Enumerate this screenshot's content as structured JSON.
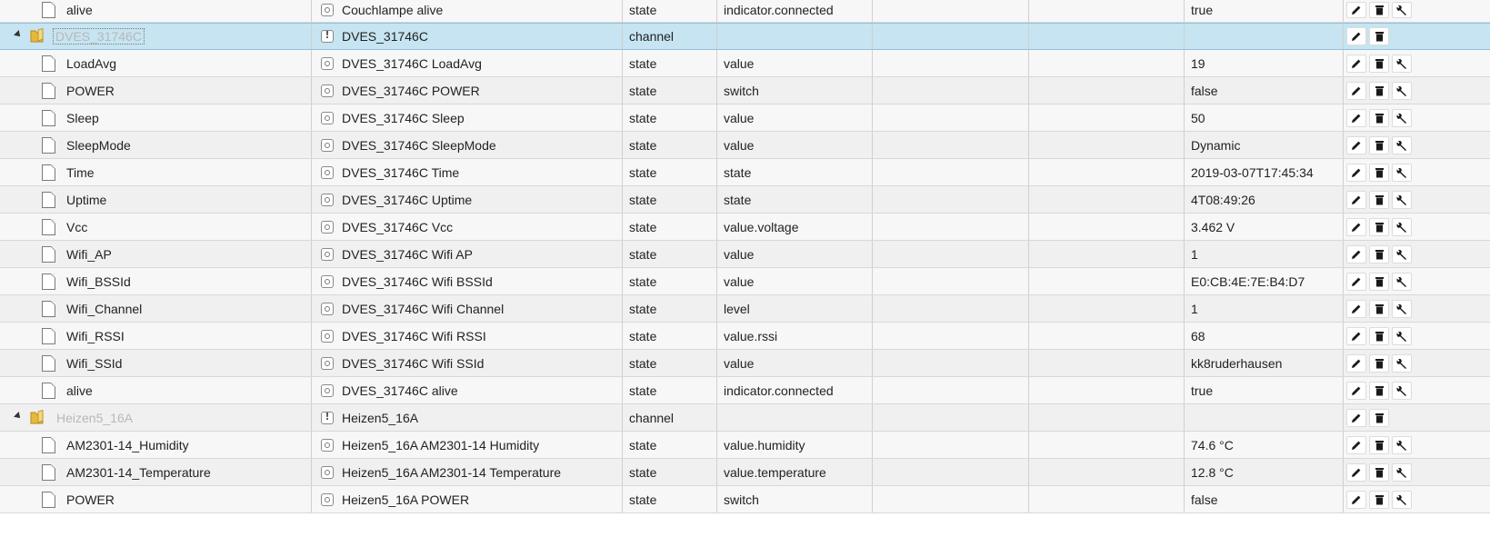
{
  "table": {
    "top_row": {
      "id": "alive",
      "name": "Couchlampe alive",
      "type": "state",
      "role": "indicator.connected",
      "value": "true"
    },
    "groups": [
      {
        "channel": {
          "id": "DVES_31746C",
          "name": "DVES_31746C",
          "type": "channel"
        },
        "rows": [
          {
            "id": "LoadAvg",
            "name": "DVES_31746C LoadAvg",
            "type": "state",
            "role": "value",
            "value": "19"
          },
          {
            "id": "POWER",
            "name": "DVES_31746C POWER",
            "type": "state",
            "role": "switch",
            "value": "false"
          },
          {
            "id": "Sleep",
            "name": "DVES_31746C Sleep",
            "type": "state",
            "role": "value",
            "value": "50"
          },
          {
            "id": "SleepMode",
            "name": "DVES_31746C SleepMode",
            "type": "state",
            "role": "value",
            "value": "Dynamic"
          },
          {
            "id": "Time",
            "name": "DVES_31746C Time",
            "type": "state",
            "role": "state",
            "value": "2019-03-07T17:45:34"
          },
          {
            "id": "Uptime",
            "name": "DVES_31746C Uptime",
            "type": "state",
            "role": "state",
            "value": "4T08:49:26"
          },
          {
            "id": "Vcc",
            "name": "DVES_31746C Vcc",
            "type": "state",
            "role": "value.voltage",
            "value": "3.462 V"
          },
          {
            "id": "Wifi_AP",
            "name": "DVES_31746C Wifi AP",
            "type": "state",
            "role": "value",
            "value": "1"
          },
          {
            "id": "Wifi_BSSId",
            "name": "DVES_31746C Wifi BSSId",
            "type": "state",
            "role": "value",
            "value": "E0:CB:4E:7E:B4:D7"
          },
          {
            "id": "Wifi_Channel",
            "name": "DVES_31746C Wifi Channel",
            "type": "state",
            "role": "level",
            "value": "1"
          },
          {
            "id": "Wifi_RSSI",
            "name": "DVES_31746C Wifi RSSI",
            "type": "state",
            "role": "value.rssi",
            "value": "68"
          },
          {
            "id": "Wifi_SSId",
            "name": "DVES_31746C Wifi SSId",
            "type": "state",
            "role": "value",
            "value": "kk8ruderhausen"
          },
          {
            "id": "alive",
            "name": "DVES_31746C alive",
            "type": "state",
            "role": "indicator.connected",
            "value": "true"
          }
        ]
      },
      {
        "channel": {
          "id": "Heizen5_16A",
          "name": "Heizen5_16A",
          "type": "channel"
        },
        "rows": [
          {
            "id": "AM2301-14_Humidity",
            "name": "Heizen5_16A AM2301-14 Humidity",
            "type": "state",
            "role": "value.humidity",
            "value": "74.6 °C"
          },
          {
            "id": "AM2301-14_Temperature",
            "name": "Heizen5_16A AM2301-14 Temperature",
            "type": "state",
            "role": "value.temperature",
            "value": "12.8 °C"
          },
          {
            "id": "POWER",
            "name": "Heizen5_16A POWER",
            "type": "state",
            "role": "switch",
            "value": "false"
          }
        ]
      }
    ]
  },
  "icons": {
    "edit": "pencil-icon",
    "delete": "trash-icon",
    "config": "wrench-icon",
    "folder": "folder-icon",
    "file": "file-icon",
    "state": "state-icon",
    "channel": "channel-icon"
  },
  "colors": {
    "selected_row": "#c6e4f1",
    "channel_id_text": "#b8b8b8",
    "header_highlight": "#f5b7b0"
  }
}
